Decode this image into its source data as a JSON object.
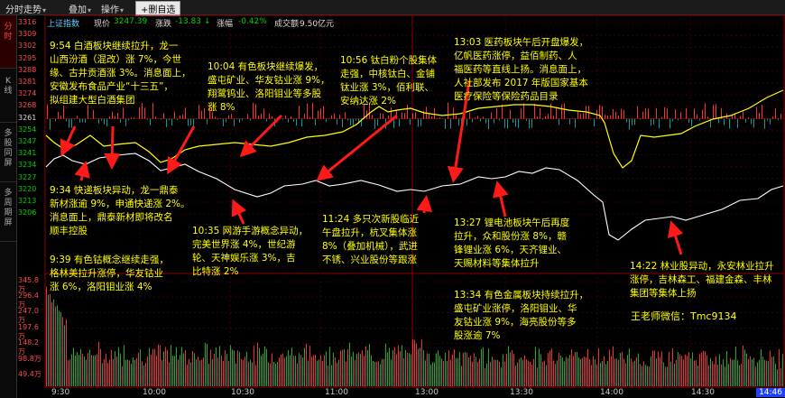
{
  "toolbar": {
    "items": [
      "分时走势",
      "叠加",
      "操作"
    ],
    "selected": "+删自选"
  },
  "sidetabs": [
    {
      "label": "分\n时",
      "active": true
    },
    {
      "label": "K\n线",
      "active": false
    },
    {
      "label": "多\n股\n同\n屏",
      "active": false
    },
    {
      "label": "多\n周\n期\n屏",
      "active": false
    }
  ],
  "info": {
    "index_name": "上证指数",
    "price_label": "现价",
    "price": "3247.39",
    "change_label": "涨跌",
    "change": "-13.83",
    "change_arrow": "↓",
    "pct_label": "涨幅",
    "pct": "-0.42%",
    "turnover_label": "成交额",
    "turnover": "9.50亿元"
  },
  "axis": {
    "price_ticks": [
      "3316",
      "3309",
      "3302",
      "3295",
      "3288",
      "3281",
      "3274",
      "3268",
      "3261",
      "3254",
      "3247",
      "3241",
      "3234",
      "3227",
      "3220",
      "3213",
      "3206"
    ],
    "volume_ticks": [
      "345.8万",
      "296.4万",
      "247.0万",
      "197.6万",
      "148.2万",
      "98.8万",
      "49.4万"
    ],
    "time_ticks": [
      "9:30",
      "10:00",
      "10:30",
      "11:00",
      "13:00",
      "13:30",
      "14:00",
      "14:30"
    ]
  },
  "annotations": [
    "9:54 白酒板块继续拉升，龙一\n山西汾酒（混改）涨 7%，今世\n缘、古井贡酒涨 3%。消息面上，\n安徽发布食品产业“十三五”，\n拟组建大型白酒集团",
    "10:04 有色板块继续爆发，\n盛屯矿业、华友钴业涨 9%，\n翔鹭钨业、洛阳钼业等多股\n涨 8%",
    "10:56 钛白粉个股集体\n走强，中核钛白、金铺\n钛业涨 3%，佰利联、\n安纳达涨 2%",
    "13:03 医药板块午后开盘爆发，\n亿帆医药涨停，益佰制药、人\n福医药等直线上扬。消息面上，\n人社部发布 2017 年版国家基本\n医疗保险等保险药品目录",
    "9:34 快递板块异动，龙一鼎泰\n新材涨逾 9%，申通快递涨 2%。\n消息面上，鼎泰新材即将改名\n顺丰控股",
    "9:39 有色钴概念继续走强，\n格林美拉升涨停，华友钴业\n涨 6%，洛阳钼业涨 4%",
    "10:35 网游手游概念异动，\n完美世界涨 4%，世纪游\n轮、天神娱乐涨 3%，吉\n比特涨 2%",
    "11:24 多只次新股临近\n午盘拉升，杭叉集体涨\n8%（叠加机械），武进\n不锈、兴业股份等跟涨",
    "13:27 锂电池板块午后再度\n拉升，众和股份涨 8%，赣\n锋锂业涨 6%，天齐锂业、\n天赐材料等集体拉升",
    "13:34 有色金属板块持续拉升，\n盛屯矿业涨停，洛阳钼业、华\n友钴业涨 9%，海亮股份等多\n股涨逾 7%",
    "14:22 林业股异动，永安林业拉升\n涨停，吉林森工、福建金森、丰林\n集团等集体上扬"
  ],
  "wechat": "王老师微信：Tmc9134",
  "time_badge": "14:46"
}
